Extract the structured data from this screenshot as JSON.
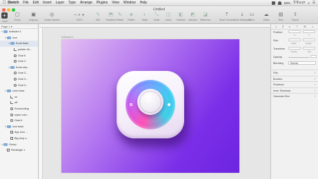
{
  "menubar": {
    "app_name": "Sketch",
    "items": [
      "File",
      "Edit",
      "Insert",
      "Layer",
      "Type",
      "Arrange",
      "Plugins",
      "View",
      "Window",
      "Help"
    ],
    "battery": "15%",
    "clock": "下午4:27"
  },
  "window": {
    "title": "Untitled",
    "traffic_colors": [
      "#fd5f57",
      "#febc2e",
      "#28c840"
    ]
  },
  "toolbar": {
    "insert_label": "Insert",
    "left_tools": [
      {
        "icon": "group-icon",
        "label": "Group",
        "glyph": "▢"
      },
      {
        "icon": "ungroup-icon",
        "label": "Ungroup",
        "glyph": "▣"
      },
      {
        "icon": "create-symbol-icon",
        "label": "Create Symbol",
        "glyph": "◎"
      }
    ],
    "zoom": {
      "minus": "−",
      "plus": "+",
      "value": "100%"
    },
    "mid_tools": [
      {
        "icon": "edit-icon",
        "label": "Edit",
        "glyph": "✎"
      },
      {
        "icon": "transform-icon",
        "label": "Transform",
        "glyph": "⬒"
      },
      {
        "icon": "rotate-icon",
        "label": "Rotate",
        "glyph": "↻"
      },
      {
        "icon": "flatten-icon",
        "label": "Flatten",
        "glyph": "◈"
      }
    ],
    "bool_tools": [
      {
        "icon": "mask-icon",
        "label": "Mask",
        "glyph": "◐"
      },
      {
        "icon": "scale-icon",
        "label": "Scale",
        "glyph": "⤡"
      },
      {
        "icon": "union-icon",
        "label": "Union",
        "glyph": "◫"
      },
      {
        "icon": "subtract-icon",
        "label": "Subtract",
        "glyph": "◧"
      },
      {
        "icon": "intersect-icon",
        "label": "Intersect",
        "glyph": "◩"
      },
      {
        "icon": "difference-icon",
        "label": "Difference",
        "glyph": "◪"
      }
    ],
    "right_tools": [
      {
        "icon": "forward-icon",
        "label": "Move Forward",
        "glyph": "⇡"
      },
      {
        "icon": "backward-icon",
        "label": "Move Backward",
        "glyph": "⇣"
      },
      {
        "icon": "mirror-icon",
        "label": "Mirror",
        "glyph": "▭"
      },
      {
        "icon": "share-icon",
        "label": "Share",
        "glyph": "☁"
      },
      {
        "icon": "view-icon",
        "label": "View",
        "glyph": "▤"
      },
      {
        "icon": "export-icon",
        "label": "Export",
        "glyph": "⇪"
      }
    ]
  },
  "layers": {
    "pages_label": "Page 1",
    "rows": [
      {
        "depth": 0,
        "caret": "▾",
        "type": "folder",
        "label": "Artboard 1",
        "selected": false
      },
      {
        "depth": 1,
        "caret": "▾",
        "type": "folder",
        "label": "icon",
        "selected": false
      },
      {
        "depth": 2,
        "caret": "▾",
        "type": "folder",
        "label": "Knob base",
        "selected": true
      },
      {
        "depth": 3,
        "caret": "",
        "type": "path",
        "label": "pointer thi...",
        "selected": false
      },
      {
        "depth": 3,
        "caret": "",
        "type": "oval",
        "label": "Oval 6",
        "selected": false
      },
      {
        "depth": 3,
        "caret": "",
        "type": "oval",
        "label": "Oval 3",
        "selected": false
      },
      {
        "depth": 2,
        "caret": "▾",
        "type": "folder",
        "label": "Knob sha...",
        "selected": false
      },
      {
        "depth": 3,
        "caret": "",
        "type": "oval",
        "label": "Oval 3...",
        "selected": false
      },
      {
        "depth": 3,
        "caret": "",
        "type": "oval",
        "label": "Oval 3...",
        "selected": false
      },
      {
        "depth": 3,
        "caret": "",
        "type": "oval",
        "label": "Oval 3...",
        "selected": false
      },
      {
        "depth": 1,
        "caret": "▾",
        "type": "folder",
        "label": "color base",
        "selected": false
      },
      {
        "depth": 2,
        "caret": "",
        "type": "path",
        "label": "on",
        "selected": false
      },
      {
        "depth": 2,
        "caret": "",
        "type": "path",
        "label": "off",
        "selected": false
      },
      {
        "depth": 2,
        "caret": "",
        "type": "oval",
        "label": "Surrounding",
        "selected": false
      },
      {
        "depth": 2,
        "caret": "",
        "type": "oval",
        "label": "super colo...",
        "selected": false
      },
      {
        "depth": 2,
        "caret": "",
        "type": "oval",
        "label": "Oval 6",
        "selected": false
      },
      {
        "depth": 1,
        "caret": "▾",
        "type": "folder",
        "label": "icon base",
        "selected": false
      },
      {
        "depth": 2,
        "caret": "",
        "type": "rect",
        "label": "App Icon ...",
        "selected": false
      },
      {
        "depth": 2,
        "caret": "",
        "type": "rect",
        "label": "Big drop s...",
        "selected": false
      },
      {
        "depth": 0,
        "caret": "▾",
        "type": "folder",
        "label": "Group",
        "selected": false
      },
      {
        "depth": 1,
        "caret": "",
        "type": "rect",
        "label": "Rectangle 1",
        "selected": false
      }
    ]
  },
  "canvas": {
    "artboard_label": "Artboard 1",
    "artboard_gradient": [
      "#e4c0f2",
      "#b072f0",
      "#7b2ee8",
      "#6c25e0"
    ],
    "ring_colors": [
      "#ff4fb3",
      "#c34ff0",
      "#6b8cff",
      "#39c6f0"
    ]
  },
  "inspector": {
    "position_label": "Position",
    "size_label": "Size",
    "transform_label": "Transform",
    "x_label": "X",
    "y_label": "Y",
    "width_label": "Width",
    "height_label": "Height",
    "rotate_label": "Rotate",
    "flip_label": "Flip",
    "opacity_label": "Opacity",
    "blending_label": "Blending",
    "blending_value": "Normal",
    "sections": [
      "Fills",
      "Borders",
      "Shadows",
      "Inner Shadows",
      "Gaussian Blur"
    ]
  }
}
